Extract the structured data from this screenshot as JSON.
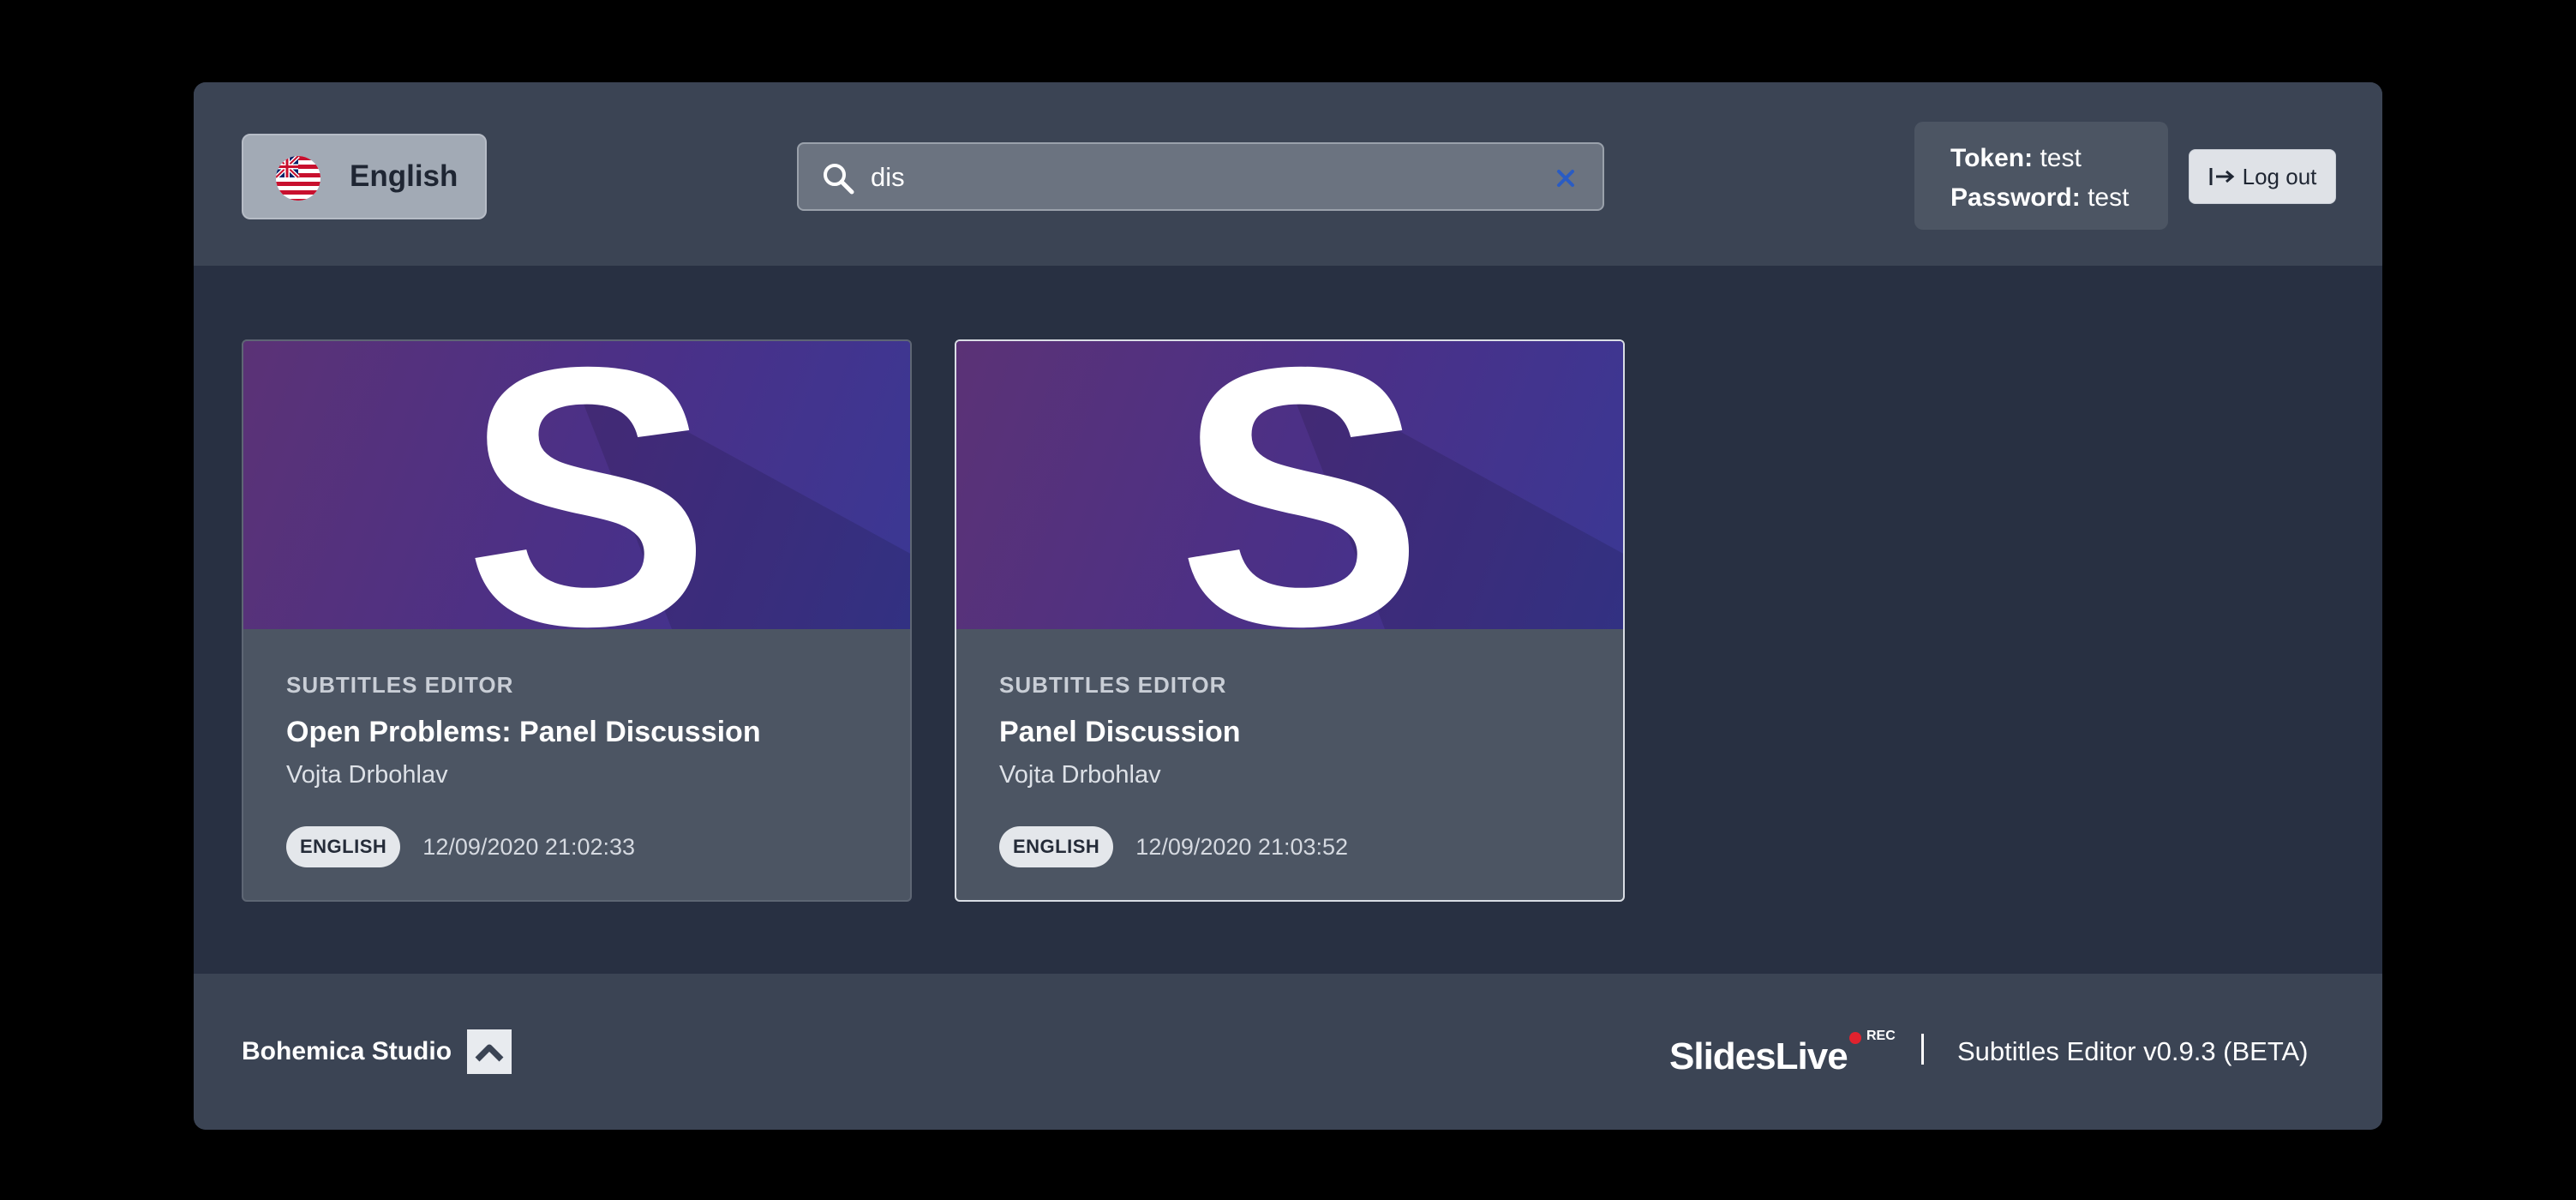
{
  "header": {
    "language": {
      "label": "English",
      "icon": "uk-flag-icon"
    },
    "search": {
      "value": "dis",
      "placeholder": "",
      "icon": "search-icon",
      "clear_icon": "close-icon"
    },
    "credentials": {
      "token_label": "Token:",
      "token_value": "test",
      "password_label": "Password:",
      "password_value": "test"
    },
    "logout": {
      "label": "Log out",
      "icon": "logout-icon"
    }
  },
  "cards": [
    {
      "eyebrow": "SUBTITLES EDITOR",
      "title": "Open Problems: Panel Discussion",
      "author": "Vojta Drbohlav",
      "language_badge": "ENGLISH",
      "timestamp": "12/09/2020 21:02:33",
      "thumbnail_letter": "S"
    },
    {
      "eyebrow": "SUBTITLES EDITOR",
      "title": "Panel Discussion",
      "author": "Vojta Drbohlav",
      "language_badge": "ENGLISH",
      "timestamp": "12/09/2020 21:03:52",
      "thumbnail_letter": "S"
    }
  ],
  "footer": {
    "studio": "Bohemica Studio",
    "studio_icon": "chevron-up-icon",
    "brand": "SlidesLive",
    "rec": "REC",
    "version": "Subtitles Editor v0.9.3 (BETA)"
  },
  "colors": {
    "page_bg": "#000000",
    "header_bg": "#3b4454",
    "content_bg": "#283042",
    "card_bg": "#4c5563",
    "thumbnail_purple": "#4a3088",
    "rec_red": "#e0222e"
  }
}
